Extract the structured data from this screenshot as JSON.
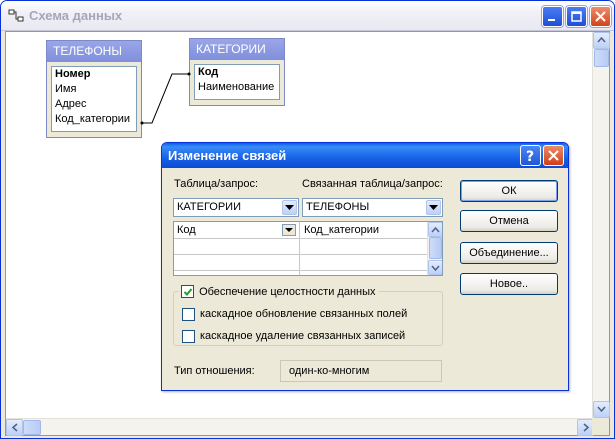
{
  "window": {
    "title": "Схема данных"
  },
  "tables": {
    "phones": {
      "title": "ТЕЛЕФОНЫ",
      "fields": [
        "Номер",
        "Имя",
        "Адрес",
        "Код_категории"
      ]
    },
    "categories": {
      "title": "КАТЕГОРИИ",
      "fields": [
        "Код",
        "Наименование"
      ]
    }
  },
  "dialog": {
    "title": "Изменение связей",
    "table_label": "Таблица/запрос:",
    "related_label": "Связанная таблица/запрос:",
    "table_value": "КАТЕГОРИИ",
    "related_value": "ТЕЛЕФОНЫ",
    "grid": {
      "left": "Код",
      "right": "Код_категории"
    },
    "buttons": {
      "ok": "ОК",
      "cancel": "Отмена",
      "join": "Объединение...",
      "new": "Новое.."
    },
    "integrity": {
      "label": "Обеспечение целостности данных",
      "checked": true
    },
    "cascade_update": {
      "label": "каскадное обновление связанных полей",
      "checked": false
    },
    "cascade_delete": {
      "label": "каскадное удаление связанных записей",
      "checked": false
    },
    "relation_type_label": "Тип отношения:",
    "relation_type_value": "один-ко-многим"
  },
  "colors": {
    "title_blue": "#0a5ee8",
    "table_header": "#8a97e0",
    "close_red": "#d0451b"
  }
}
